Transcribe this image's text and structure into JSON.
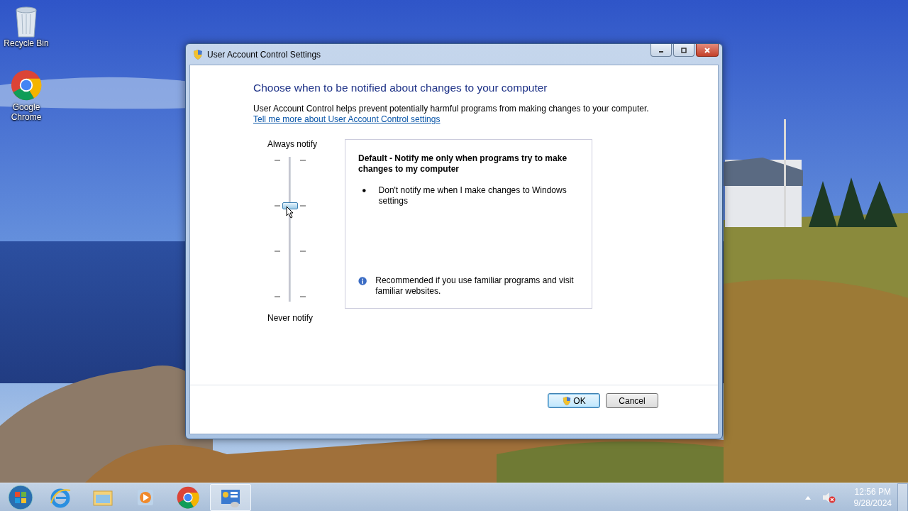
{
  "desktop_icons": [
    {
      "kind": "recycle",
      "label": "Recycle Bin"
    },
    {
      "kind": "chrome",
      "label": "Google Chrome"
    }
  ],
  "window": {
    "title": "User Account Control Settings",
    "heading": "Choose when to be notified about changes to your computer",
    "description": "User Account Control helps prevent potentially harmful programs from making changes to your computer.",
    "link": "Tell me more about User Account Control settings",
    "slider": {
      "top_label": "Always notify",
      "bottom_label": "Never notify",
      "level": 0.6667
    },
    "info": {
      "title": "Default - Notify me only when programs try to make changes to my computer",
      "bullets": [
        "Don't notify me when I make changes to Windows settings"
      ],
      "recommendation": "Recommended if you use familiar programs and visit familiar websites."
    },
    "buttons": [
      {
        "label": "OK",
        "shield": true,
        "default": true
      },
      {
        "label": "Cancel",
        "shield": false,
        "default": false
      }
    ]
  },
  "taskbar": {
    "items": [
      {
        "kind": "ie",
        "selected": false
      },
      {
        "kind": "explorer",
        "selected": false
      },
      {
        "kind": "media",
        "selected": false
      },
      {
        "kind": "chrome",
        "selected": false
      },
      {
        "kind": "uac",
        "selected": true
      }
    ],
    "volume_muted": true,
    "time": "12:56 PM",
    "date": "9/28/2024"
  }
}
